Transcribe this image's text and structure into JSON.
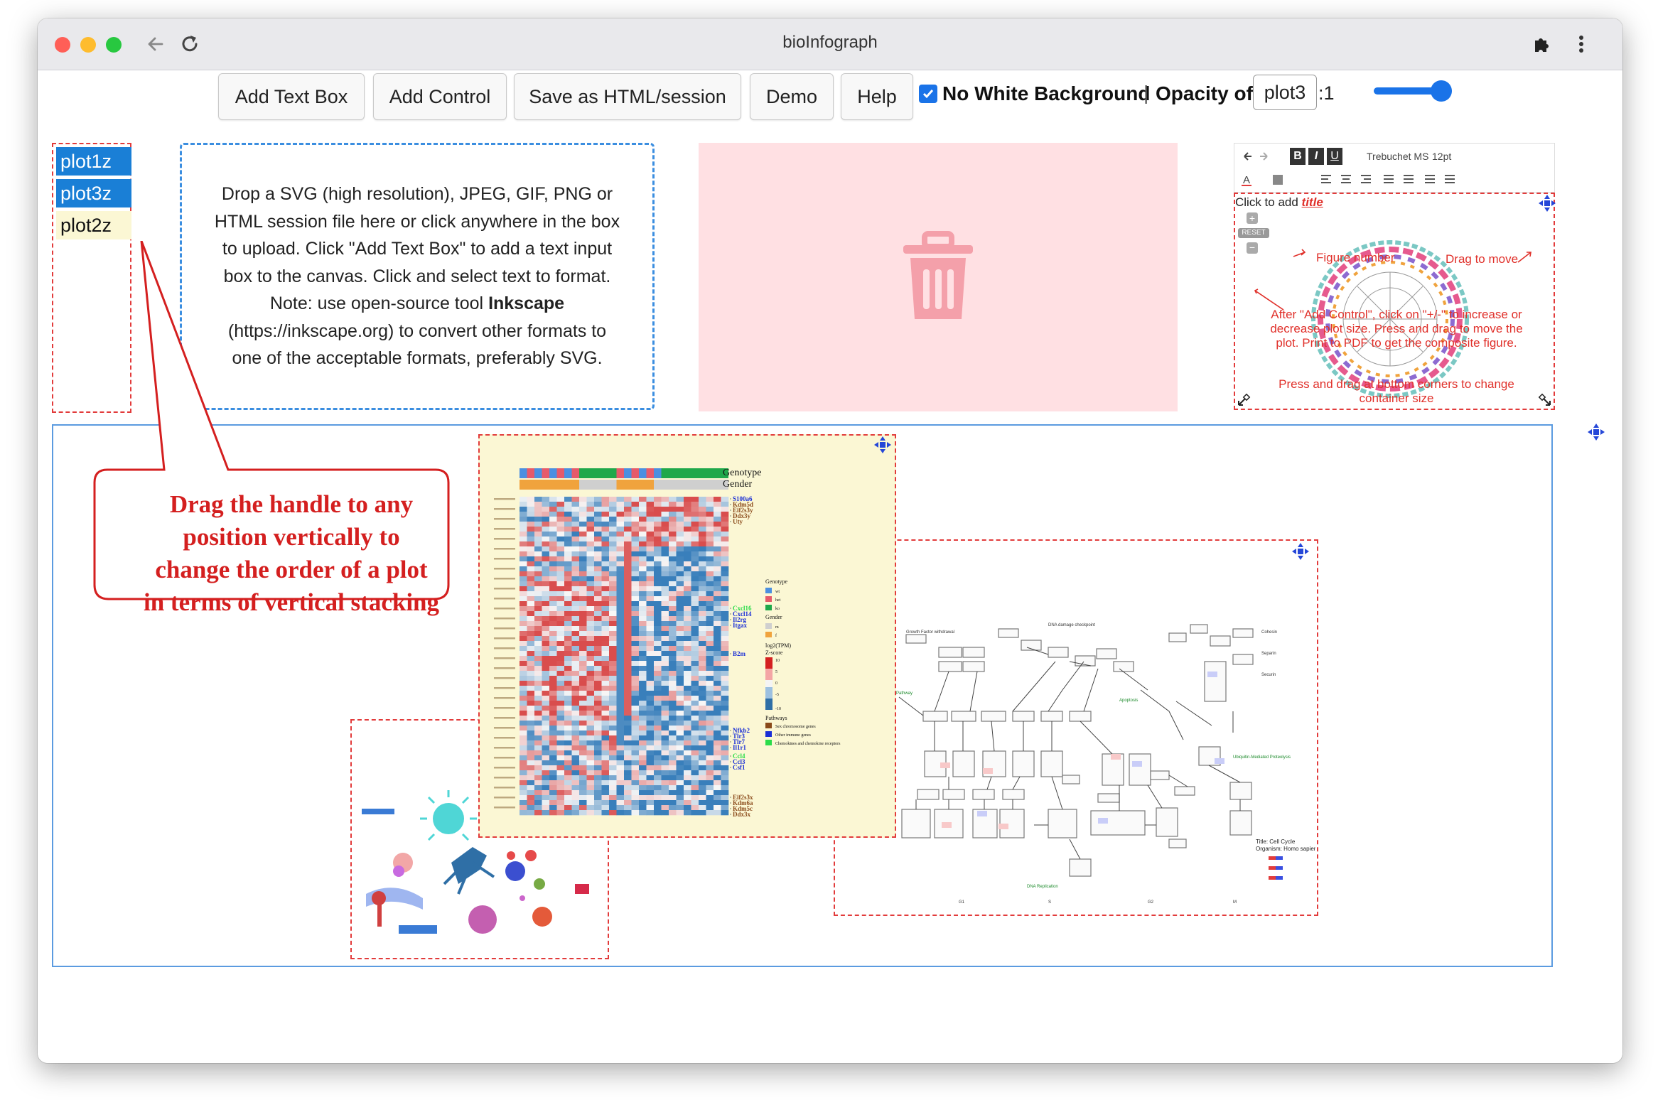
{
  "window": {
    "title": "bioInfograph",
    "traffic_lights": [
      "#ff5f57",
      "#febc2e",
      "#28c840"
    ]
  },
  "toolbar": {
    "add_text_box": "Add Text Box",
    "add_control": "Add Control",
    "save_session": "Save as HTML/session",
    "demo": "Demo",
    "help": "Help",
    "no_white_bg_checked": true,
    "no_white_bg_label": "No White Background",
    "separator": "|",
    "opacity_label": "Opacity of",
    "opacity_plot_value": "plot3",
    "opacity_suffix": ":1",
    "opacity_level": 0.8
  },
  "plot_list": {
    "items": [
      {
        "label": "plot1z",
        "selected": true
      },
      {
        "label": "plot3z",
        "selected": true
      },
      {
        "label": "plot2z",
        "selected": false
      }
    ]
  },
  "dropzone": {
    "line1": "Drop a SVG (high resolution), JPEG, GIF, PNG or",
    "line2": "HTML session file here or click anywhere in the box",
    "line3": "to upload. Click \"Add Text Box\" to add a text input",
    "line4": "box to the canvas. Click and select text to format.",
    "line5_pre": "Note: use open-source tool ",
    "line5_bold": "Inkscape",
    "line6": "(https://inkscape.org) to convert other formats to",
    "line7": "one of the acceptable formats, preferably SVG."
  },
  "trash": {
    "icon": "trash-icon",
    "color": "#f4a0aa"
  },
  "editor": {
    "font_name": "Trebuchet MS",
    "font_size": "12pt",
    "title_prefix": "Click to add ",
    "title_link": "title",
    "reset_label": "RESET",
    "ann_figure_number": "Figure number",
    "ann_drag_move": "Drag to move",
    "ann_after_1": "After \"Add Control\", click on \"+/-\" to increase or",
    "ann_after_2": "decrease plot size. Press and drag to move the",
    "ann_after_3": "plot. Print to PDF to get the composite figure.",
    "ann_corner_1": "Press and drag at bottom corners to change",
    "ann_corner_2": "container size"
  },
  "callout": {
    "line1": "Drag the handle to any",
    "line2": "position vertically  to",
    "line3": "change  the order of a plot",
    "line4": "in terms of vertical stacking"
  },
  "heatmap": {
    "legend_top_1": "Genotype",
    "legend_top_2": "Gender",
    "gene_labels_top": [
      "S100a6",
      "Kdm5d",
      "Eif2s3y",
      "Ddx3y",
      "Uty"
    ],
    "gene_labels_mid": [
      "Cxcl16",
      "Cxcl14",
      "Il2rg",
      "Itgax"
    ],
    "gene_label_b2m": "B2m",
    "gene_labels_low": [
      "Nfkb2",
      "Tlr3",
      "Tlr7",
      "Il1r1"
    ],
    "gene_labels_low2": [
      "Ccl4",
      "Ccl3",
      "Csf1"
    ],
    "gene_labels_bottom": [
      "Eif2s3x",
      "Kdm6a",
      "Kdm5c",
      "Ddx3x"
    ],
    "legend": {
      "genotype_title": "Genotype",
      "genotype_items": [
        "wt",
        "het",
        "ko"
      ],
      "gender_title": "Gender",
      "gender_items": [
        "m",
        "f"
      ],
      "scale_title_1": "log2(TPM)",
      "scale_title_2": "Z-score",
      "scale_ticks": [
        "10",
        "5",
        "0",
        "-5",
        "-10"
      ],
      "pathways_title": "Pathways",
      "pathway_items": [
        "Sex chromosome genes",
        "Other immune genes",
        "Chemokines and chemokine receptors"
      ]
    }
  },
  "pathway": {
    "title_line1": "Title: Cell Cycle",
    "title_line2": "Organism: Homo sapiens",
    "labels": {
      "growth": "Growth Factor withdrawal",
      "dna_damage": "DNA damage checkpoint",
      "apoptosis": "Apoptosis",
      "ubiquitin": "Ubiquitin-Mediated Proteolysis",
      "dna_replication": "DNA Replication",
      "pathway": "Pathway",
      "cohesin": "Cohesin",
      "separin": "Separin",
      "securin": "Securin",
      "g1": "G1",
      "s": "S",
      "g2": "G2",
      "m": "M"
    }
  }
}
